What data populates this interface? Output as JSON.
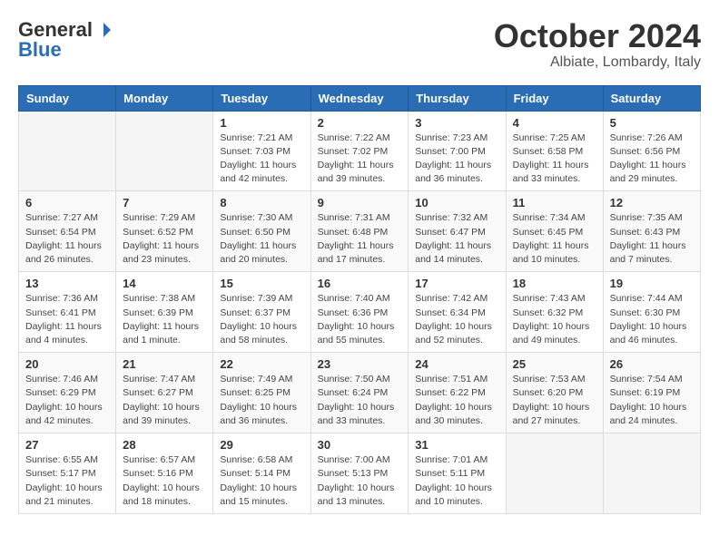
{
  "header": {
    "logo_general": "General",
    "logo_blue": "Blue",
    "month": "October 2024",
    "location": "Albiate, Lombardy, Italy"
  },
  "days_of_week": [
    "Sunday",
    "Monday",
    "Tuesday",
    "Wednesday",
    "Thursday",
    "Friday",
    "Saturday"
  ],
  "weeks": [
    [
      {
        "day": "",
        "info": ""
      },
      {
        "day": "",
        "info": ""
      },
      {
        "day": "1",
        "info": "Sunrise: 7:21 AM\nSunset: 7:03 PM\nDaylight: 11 hours and 42 minutes."
      },
      {
        "day": "2",
        "info": "Sunrise: 7:22 AM\nSunset: 7:02 PM\nDaylight: 11 hours and 39 minutes."
      },
      {
        "day": "3",
        "info": "Sunrise: 7:23 AM\nSunset: 7:00 PM\nDaylight: 11 hours and 36 minutes."
      },
      {
        "day": "4",
        "info": "Sunrise: 7:25 AM\nSunset: 6:58 PM\nDaylight: 11 hours and 33 minutes."
      },
      {
        "day": "5",
        "info": "Sunrise: 7:26 AM\nSunset: 6:56 PM\nDaylight: 11 hours and 29 minutes."
      }
    ],
    [
      {
        "day": "6",
        "info": "Sunrise: 7:27 AM\nSunset: 6:54 PM\nDaylight: 11 hours and 26 minutes."
      },
      {
        "day": "7",
        "info": "Sunrise: 7:29 AM\nSunset: 6:52 PM\nDaylight: 11 hours and 23 minutes."
      },
      {
        "day": "8",
        "info": "Sunrise: 7:30 AM\nSunset: 6:50 PM\nDaylight: 11 hours and 20 minutes."
      },
      {
        "day": "9",
        "info": "Sunrise: 7:31 AM\nSunset: 6:48 PM\nDaylight: 11 hours and 17 minutes."
      },
      {
        "day": "10",
        "info": "Sunrise: 7:32 AM\nSunset: 6:47 PM\nDaylight: 11 hours and 14 minutes."
      },
      {
        "day": "11",
        "info": "Sunrise: 7:34 AM\nSunset: 6:45 PM\nDaylight: 11 hours and 10 minutes."
      },
      {
        "day": "12",
        "info": "Sunrise: 7:35 AM\nSunset: 6:43 PM\nDaylight: 11 hours and 7 minutes."
      }
    ],
    [
      {
        "day": "13",
        "info": "Sunrise: 7:36 AM\nSunset: 6:41 PM\nDaylight: 11 hours and 4 minutes."
      },
      {
        "day": "14",
        "info": "Sunrise: 7:38 AM\nSunset: 6:39 PM\nDaylight: 11 hours and 1 minute."
      },
      {
        "day": "15",
        "info": "Sunrise: 7:39 AM\nSunset: 6:37 PM\nDaylight: 10 hours and 58 minutes."
      },
      {
        "day": "16",
        "info": "Sunrise: 7:40 AM\nSunset: 6:36 PM\nDaylight: 10 hours and 55 minutes."
      },
      {
        "day": "17",
        "info": "Sunrise: 7:42 AM\nSunset: 6:34 PM\nDaylight: 10 hours and 52 minutes."
      },
      {
        "day": "18",
        "info": "Sunrise: 7:43 AM\nSunset: 6:32 PM\nDaylight: 10 hours and 49 minutes."
      },
      {
        "day": "19",
        "info": "Sunrise: 7:44 AM\nSunset: 6:30 PM\nDaylight: 10 hours and 46 minutes."
      }
    ],
    [
      {
        "day": "20",
        "info": "Sunrise: 7:46 AM\nSunset: 6:29 PM\nDaylight: 10 hours and 42 minutes."
      },
      {
        "day": "21",
        "info": "Sunrise: 7:47 AM\nSunset: 6:27 PM\nDaylight: 10 hours and 39 minutes."
      },
      {
        "day": "22",
        "info": "Sunrise: 7:49 AM\nSunset: 6:25 PM\nDaylight: 10 hours and 36 minutes."
      },
      {
        "day": "23",
        "info": "Sunrise: 7:50 AM\nSunset: 6:24 PM\nDaylight: 10 hours and 33 minutes."
      },
      {
        "day": "24",
        "info": "Sunrise: 7:51 AM\nSunset: 6:22 PM\nDaylight: 10 hours and 30 minutes."
      },
      {
        "day": "25",
        "info": "Sunrise: 7:53 AM\nSunset: 6:20 PM\nDaylight: 10 hours and 27 minutes."
      },
      {
        "day": "26",
        "info": "Sunrise: 7:54 AM\nSunset: 6:19 PM\nDaylight: 10 hours and 24 minutes."
      }
    ],
    [
      {
        "day": "27",
        "info": "Sunrise: 6:55 AM\nSunset: 5:17 PM\nDaylight: 10 hours and 21 minutes."
      },
      {
        "day": "28",
        "info": "Sunrise: 6:57 AM\nSunset: 5:16 PM\nDaylight: 10 hours and 18 minutes."
      },
      {
        "day": "29",
        "info": "Sunrise: 6:58 AM\nSunset: 5:14 PM\nDaylight: 10 hours and 15 minutes."
      },
      {
        "day": "30",
        "info": "Sunrise: 7:00 AM\nSunset: 5:13 PM\nDaylight: 10 hours and 13 minutes."
      },
      {
        "day": "31",
        "info": "Sunrise: 7:01 AM\nSunset: 5:11 PM\nDaylight: 10 hours and 10 minutes."
      },
      {
        "day": "",
        "info": ""
      },
      {
        "day": "",
        "info": ""
      }
    ]
  ]
}
